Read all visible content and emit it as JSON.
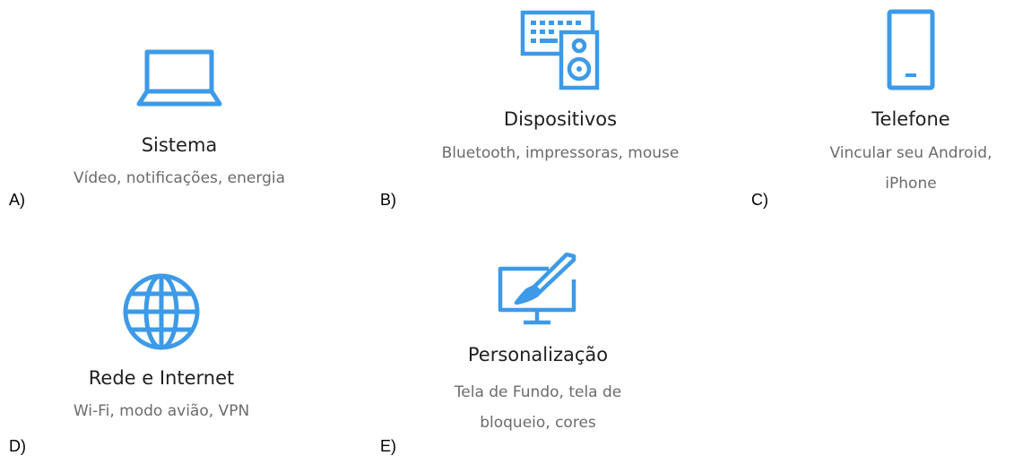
{
  "accent_color": "#3d9ae8",
  "tiles": [
    {
      "icon": "laptop-icon",
      "title": "Sistema",
      "desc": "Vídeo, notificações, energia",
      "letter": "A)"
    },
    {
      "icon": "devices-keyboard-speaker-icon",
      "title": "Dispositivos",
      "desc": "Bluetooth, impressoras, mouse",
      "letter": "B)"
    },
    {
      "icon": "phone-icon",
      "title": "Telefone",
      "desc": "Vincular seu Android, iPhone",
      "letter": "C)"
    },
    {
      "icon": "globe-icon",
      "title": "Rede e Internet",
      "desc": "Wi-Fi, modo avião, VPN",
      "letter": "D)"
    },
    {
      "icon": "personalization-brush-monitor-icon",
      "title": "Personalização",
      "desc": "Tela de Fundo, tela de bloqueio, cores",
      "letter": "E)"
    }
  ]
}
